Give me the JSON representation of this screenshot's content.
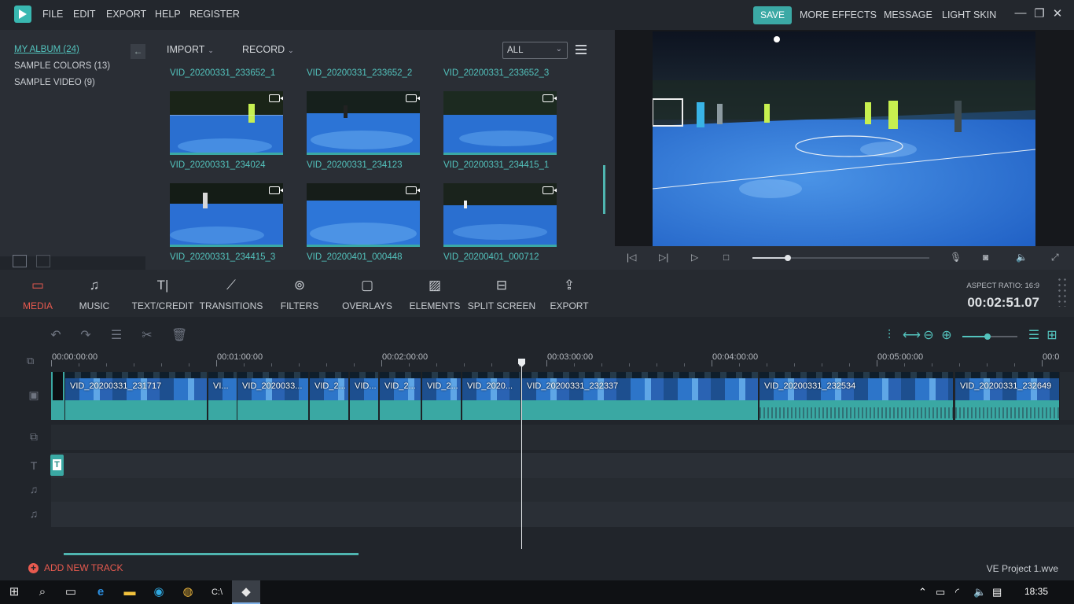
{
  "menu": [
    "FILE",
    "EDIT",
    "EXPORT",
    "HELP",
    "REGISTER"
  ],
  "topright": {
    "save": "SAVE",
    "more_effects": "MORE EFFECTS",
    "message": "MESSAGE",
    "light_skin": "LIGHT SKIN"
  },
  "album": [
    "MY ALBUM (24)",
    "SAMPLE COLORS (13)",
    "SAMPLE VIDEO (9)"
  ],
  "media": {
    "import": "IMPORT",
    "record": "RECORD",
    "filter": "ALL",
    "top_names": [
      "VID_20200331_233652_1",
      "VID_20200331_233652_2",
      "VID_20200331_233652_3"
    ],
    "clips": [
      {
        "name": "VID_20200331_234024"
      },
      {
        "name": "VID_20200331_234123"
      },
      {
        "name": "VID_20200331_234415_1"
      },
      {
        "name": "VID_20200331_234415_3"
      },
      {
        "name": "VID_20200401_000448"
      },
      {
        "name": "VID_20200401_000712"
      }
    ]
  },
  "preview": {
    "progress": 0.2
  },
  "tools": [
    {
      "label": "MEDIA",
      "icon": "folder-icon",
      "glyph": "▭"
    },
    {
      "label": "MUSIC",
      "icon": "music-icon",
      "glyph": "♫"
    },
    {
      "label": "TEXT/CREDIT",
      "icon": "text-icon",
      "glyph": "T|"
    },
    {
      "label": "TRANSITIONS",
      "icon": "transitions-icon",
      "glyph": "⟋"
    },
    {
      "label": "FILTERS",
      "icon": "filters-icon",
      "glyph": "⊚"
    },
    {
      "label": "OVERLAYS",
      "icon": "overlays-icon",
      "glyph": "▢"
    },
    {
      "label": "ELEMENTS",
      "icon": "elements-icon",
      "glyph": "▨"
    },
    {
      "label": "SPLIT SCREEN",
      "icon": "split-screen-icon",
      "glyph": "⊟"
    },
    {
      "label": "EXPORT",
      "icon": "export-icon",
      "glyph": "⇪"
    }
  ],
  "aspect_ratio": "ASPECT RATIO: 16:9",
  "timecode": "00:02:51.07",
  "ruler_labels": [
    "00:00:00:00",
    "00:01:00:00",
    "00:02:00:00",
    "00:03:00:00",
    "00:04:00:00",
    "00:05:00:00",
    "00:0"
  ],
  "timeline_clips": [
    {
      "label": "VID_20200331_231717"
    },
    {
      "label": "VI..."
    },
    {
      "label": "VID_2020033..."
    },
    {
      "label": "VID_2..."
    },
    {
      "label": "VID..."
    },
    {
      "label": "VID_2..."
    },
    {
      "label": "VID_2..."
    },
    {
      "label": "VID_2020..."
    },
    {
      "label": "VID_20200331_232337"
    },
    {
      "label": "VID_20200331_232534"
    },
    {
      "label": "VID_20200331_232649"
    }
  ],
  "text_marker": "T",
  "add_track": "ADD NEW TRACK",
  "project_name": "VE Project 1.wve",
  "clock": "18:35"
}
